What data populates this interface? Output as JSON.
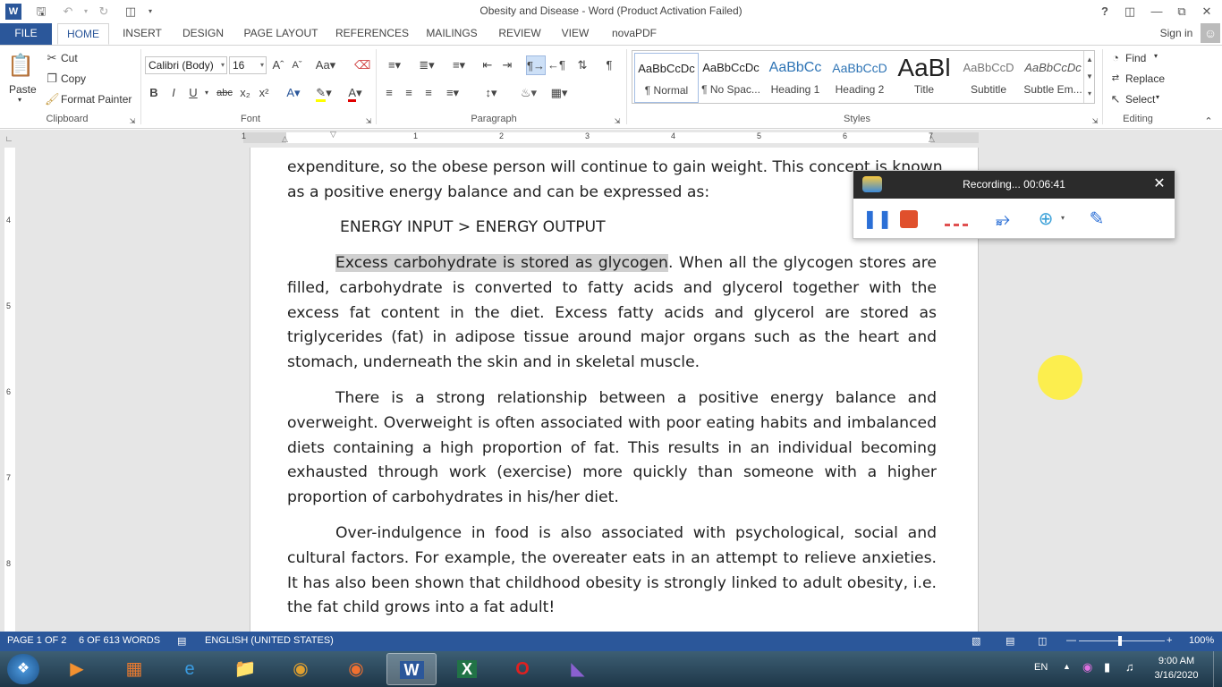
{
  "window": {
    "title": "Obesity and Disease - Word (Product Activation Failed)"
  },
  "tabs": [
    "FILE",
    "HOME",
    "INSERT",
    "DESIGN",
    "PAGE LAYOUT",
    "REFERENCES",
    "MAILINGS",
    "REVIEW",
    "VIEW",
    "novaPDF"
  ],
  "sign_in": "Sign in",
  "clipboard": {
    "paste": "Paste",
    "cut": "Cut",
    "copy": "Copy",
    "format_painter": "Format Painter",
    "label": "Clipboard"
  },
  "font": {
    "name": "Calibri (Body)",
    "size": "16",
    "label": "Font",
    "bold": "B",
    "italic": "I",
    "underline": "U",
    "strike": "abc",
    "sub": "x₂",
    "sup": "x²"
  },
  "paragraph": {
    "label": "Paragraph"
  },
  "styles": {
    "label": "Styles",
    "items": [
      {
        "preview": "AaBbCcDc",
        "name": "¶ Normal"
      },
      {
        "preview": "AaBbCcDc",
        "name": "¶ No Spac..."
      },
      {
        "preview": "AaBbCc",
        "name": "Heading 1"
      },
      {
        "preview": "AaBbCcD",
        "name": "Heading 2"
      },
      {
        "preview": "AaBl",
        "name": "Title"
      },
      {
        "preview": "AaBbCcD",
        "name": "Subtitle"
      },
      {
        "preview": "AaBbCcDc",
        "name": "Subtle Em..."
      }
    ]
  },
  "editing": {
    "find": "Find",
    "replace": "Replace",
    "select": "Select",
    "label": "Editing"
  },
  "ruler": {
    "numbers": [
      "1",
      "1",
      "2",
      "3",
      "4",
      "5",
      "6",
      "7"
    ],
    "vnumbers": [
      "4",
      "5",
      "6",
      "7",
      "8"
    ]
  },
  "document": {
    "line1": "expenditure, so the obese person will continue to gain weight. This concept is known",
    "line2": "as a positive energy balance and can be expressed as:",
    "equation": "ENERGY INPUT > ENERGY OUTPUT",
    "para1_highlight": "Excess carbohydrate is stored as glycogen",
    "para1_rest": ". When all the glycogen stores are filled, carbohydrate is converted to fatty acids and glycerol together with the excess fat content in the diet. Excess fatty acids and glycerol are stored as triglycerides (fat) in adipose tissue around major organs such as the heart and stomach, underneath the skin and in skeletal muscle.",
    "para2": "There is a strong relationship between a positive energy balance and overweight. Overweight is often associated with poor eating habits and imbalanced diets containing a high proportion of fat. This results in an individual becoming exhausted through work (exercise) more quickly than someone with a higher proportion of carbohydrates in his/her diet.",
    "para3": "Over-indulgence in food is also associated with psychological, social and cultural factors. For example, the overeater eats in an attempt to relieve anxieties. It has also been shown that childhood obesity is strongly linked to adult obesity, i.e. the fat child grows into a fat adult!"
  },
  "recorder": {
    "status": "Recording... 00:06:41"
  },
  "statusbar": {
    "page": "PAGE 1 OF 2",
    "words": "6 OF 613 WORDS",
    "language": "ENGLISH (UNITED STATES)",
    "zoom": "100%"
  },
  "taskbar": {
    "lang": "EN",
    "time": "9:00 AM",
    "date": "3/16/2020"
  }
}
